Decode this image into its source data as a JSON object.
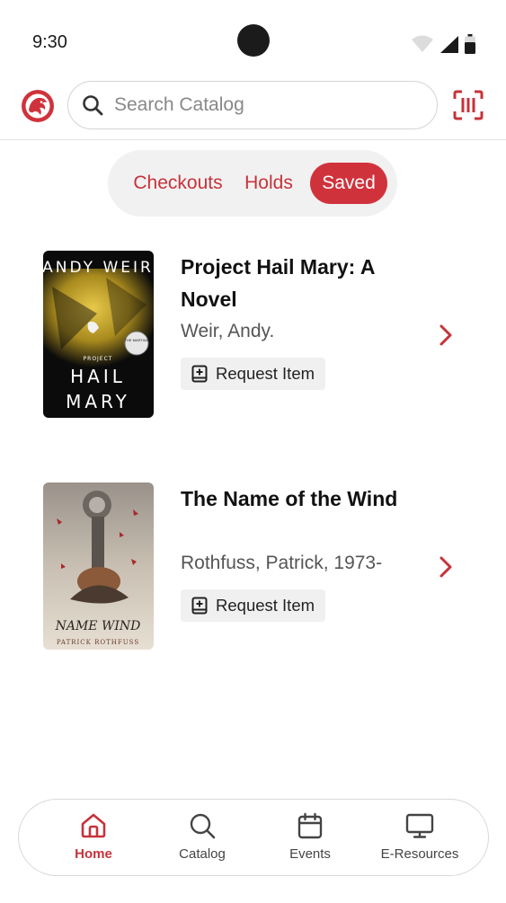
{
  "status_bar": {
    "time": "9:30"
  },
  "header": {
    "search": {
      "placeholder": "Search Catalog",
      "value": ""
    }
  },
  "tabs": [
    {
      "label": "Checkouts",
      "active": false
    },
    {
      "label": "Holds",
      "active": false
    },
    {
      "label": "Saved",
      "active": true
    }
  ],
  "saved_items": [
    {
      "title": "Project Hail Mary: A Novel",
      "author": "Weir, Andy.",
      "action_label": "Request Item",
      "cover_text": {
        "author": "ANDY WEIR",
        "line1": "HAIL",
        "line2": "MARY",
        "kicker": "PROJECT",
        "badge": "THE MARTIAN"
      }
    },
    {
      "title": "The Name of the Wind",
      "author": "Rothfuss, Patrick, 1973-",
      "action_label": "Request Item",
      "cover_text": {
        "title": "NAME WIND",
        "author": "PATRICK ROTHFUSS",
        "small": "of the"
      }
    }
  ],
  "bottom_nav": [
    {
      "label": "Home",
      "icon": "home-icon",
      "active": true
    },
    {
      "label": "Catalog",
      "icon": "search-icon",
      "active": false
    },
    {
      "label": "Events",
      "icon": "calendar-icon",
      "active": false
    },
    {
      "label": "E-Resources",
      "icon": "monitor-icon",
      "active": false
    }
  ],
  "colors": {
    "accent": "#d0323c",
    "accent_text": "#c7323a"
  }
}
